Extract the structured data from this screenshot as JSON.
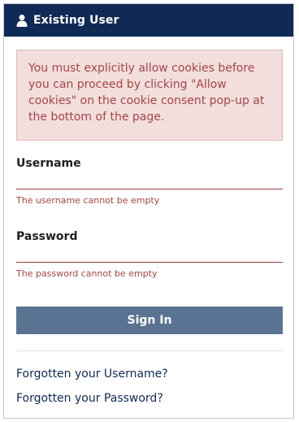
{
  "header": {
    "title": "Existing User",
    "icon": "user-icon",
    "background_color": "#0f2a54"
  },
  "alert": {
    "message": "You must explicitly allow cookies before you can proceed by clicking \"Allow cookies\" on the cookie consent pop-up at the bottom of the page."
  },
  "form": {
    "username": {
      "label": "Username",
      "value": "",
      "error": "The username cannot be empty"
    },
    "password": {
      "label": "Password",
      "value": "",
      "error": "The password cannot be empty"
    },
    "submit_label": "Sign In"
  },
  "links": {
    "forgot_username": "Forgotten your Username?",
    "forgot_password": "Forgotten your Password?"
  },
  "colors": {
    "error_text": "#a64545",
    "alert_background": "#f3dede",
    "button_background": "#5b7393"
  }
}
